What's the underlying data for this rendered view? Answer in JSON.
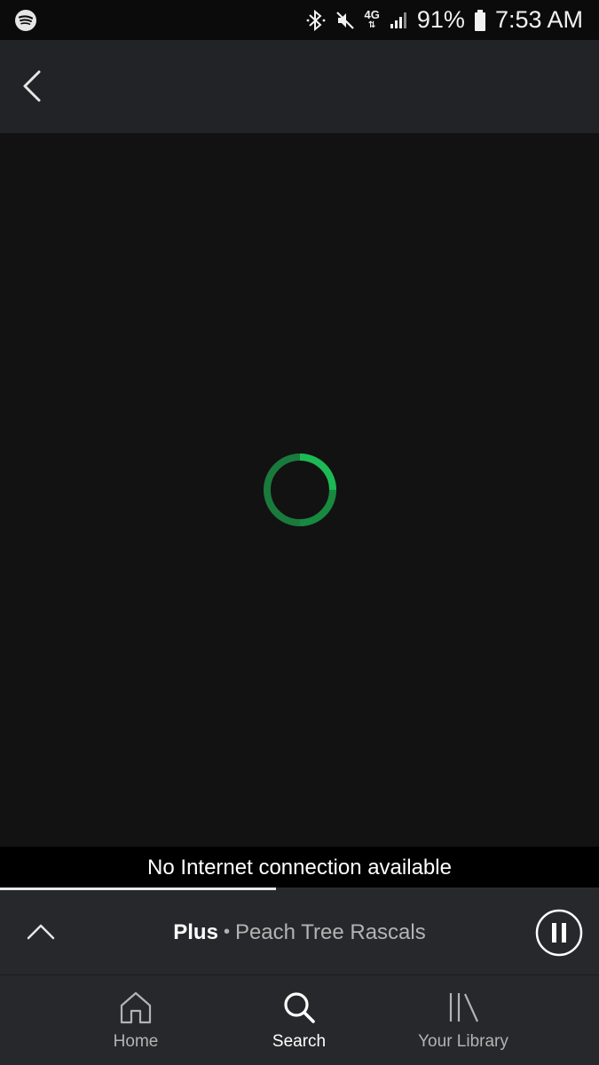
{
  "status_bar": {
    "app_icon": "spotify-icon",
    "icons": [
      "bluetooth-icon",
      "mute-icon",
      "network-4g-icon",
      "signal-icon",
      "battery-icon"
    ],
    "network_label": "4G",
    "battery_percent": "91%",
    "time": "7:53 AM"
  },
  "header": {
    "back_icon": "chevron-left-icon"
  },
  "content": {
    "loading_indicator": "spinner",
    "accent_color": "#1db954"
  },
  "offline_banner": {
    "message": "No Internet connection available",
    "progress_fraction": 0.46
  },
  "now_playing": {
    "expand_icon": "chevron-up-icon",
    "title": "Plus",
    "separator": "•",
    "artist": "Peach Tree Rascals",
    "control_icon": "pause-icon"
  },
  "nav": {
    "items": [
      {
        "label": "Home",
        "icon": "home-icon",
        "active": false
      },
      {
        "label": "Search",
        "icon": "search-icon",
        "active": true
      },
      {
        "label": "Your Library",
        "icon": "library-icon",
        "active": false
      }
    ]
  }
}
